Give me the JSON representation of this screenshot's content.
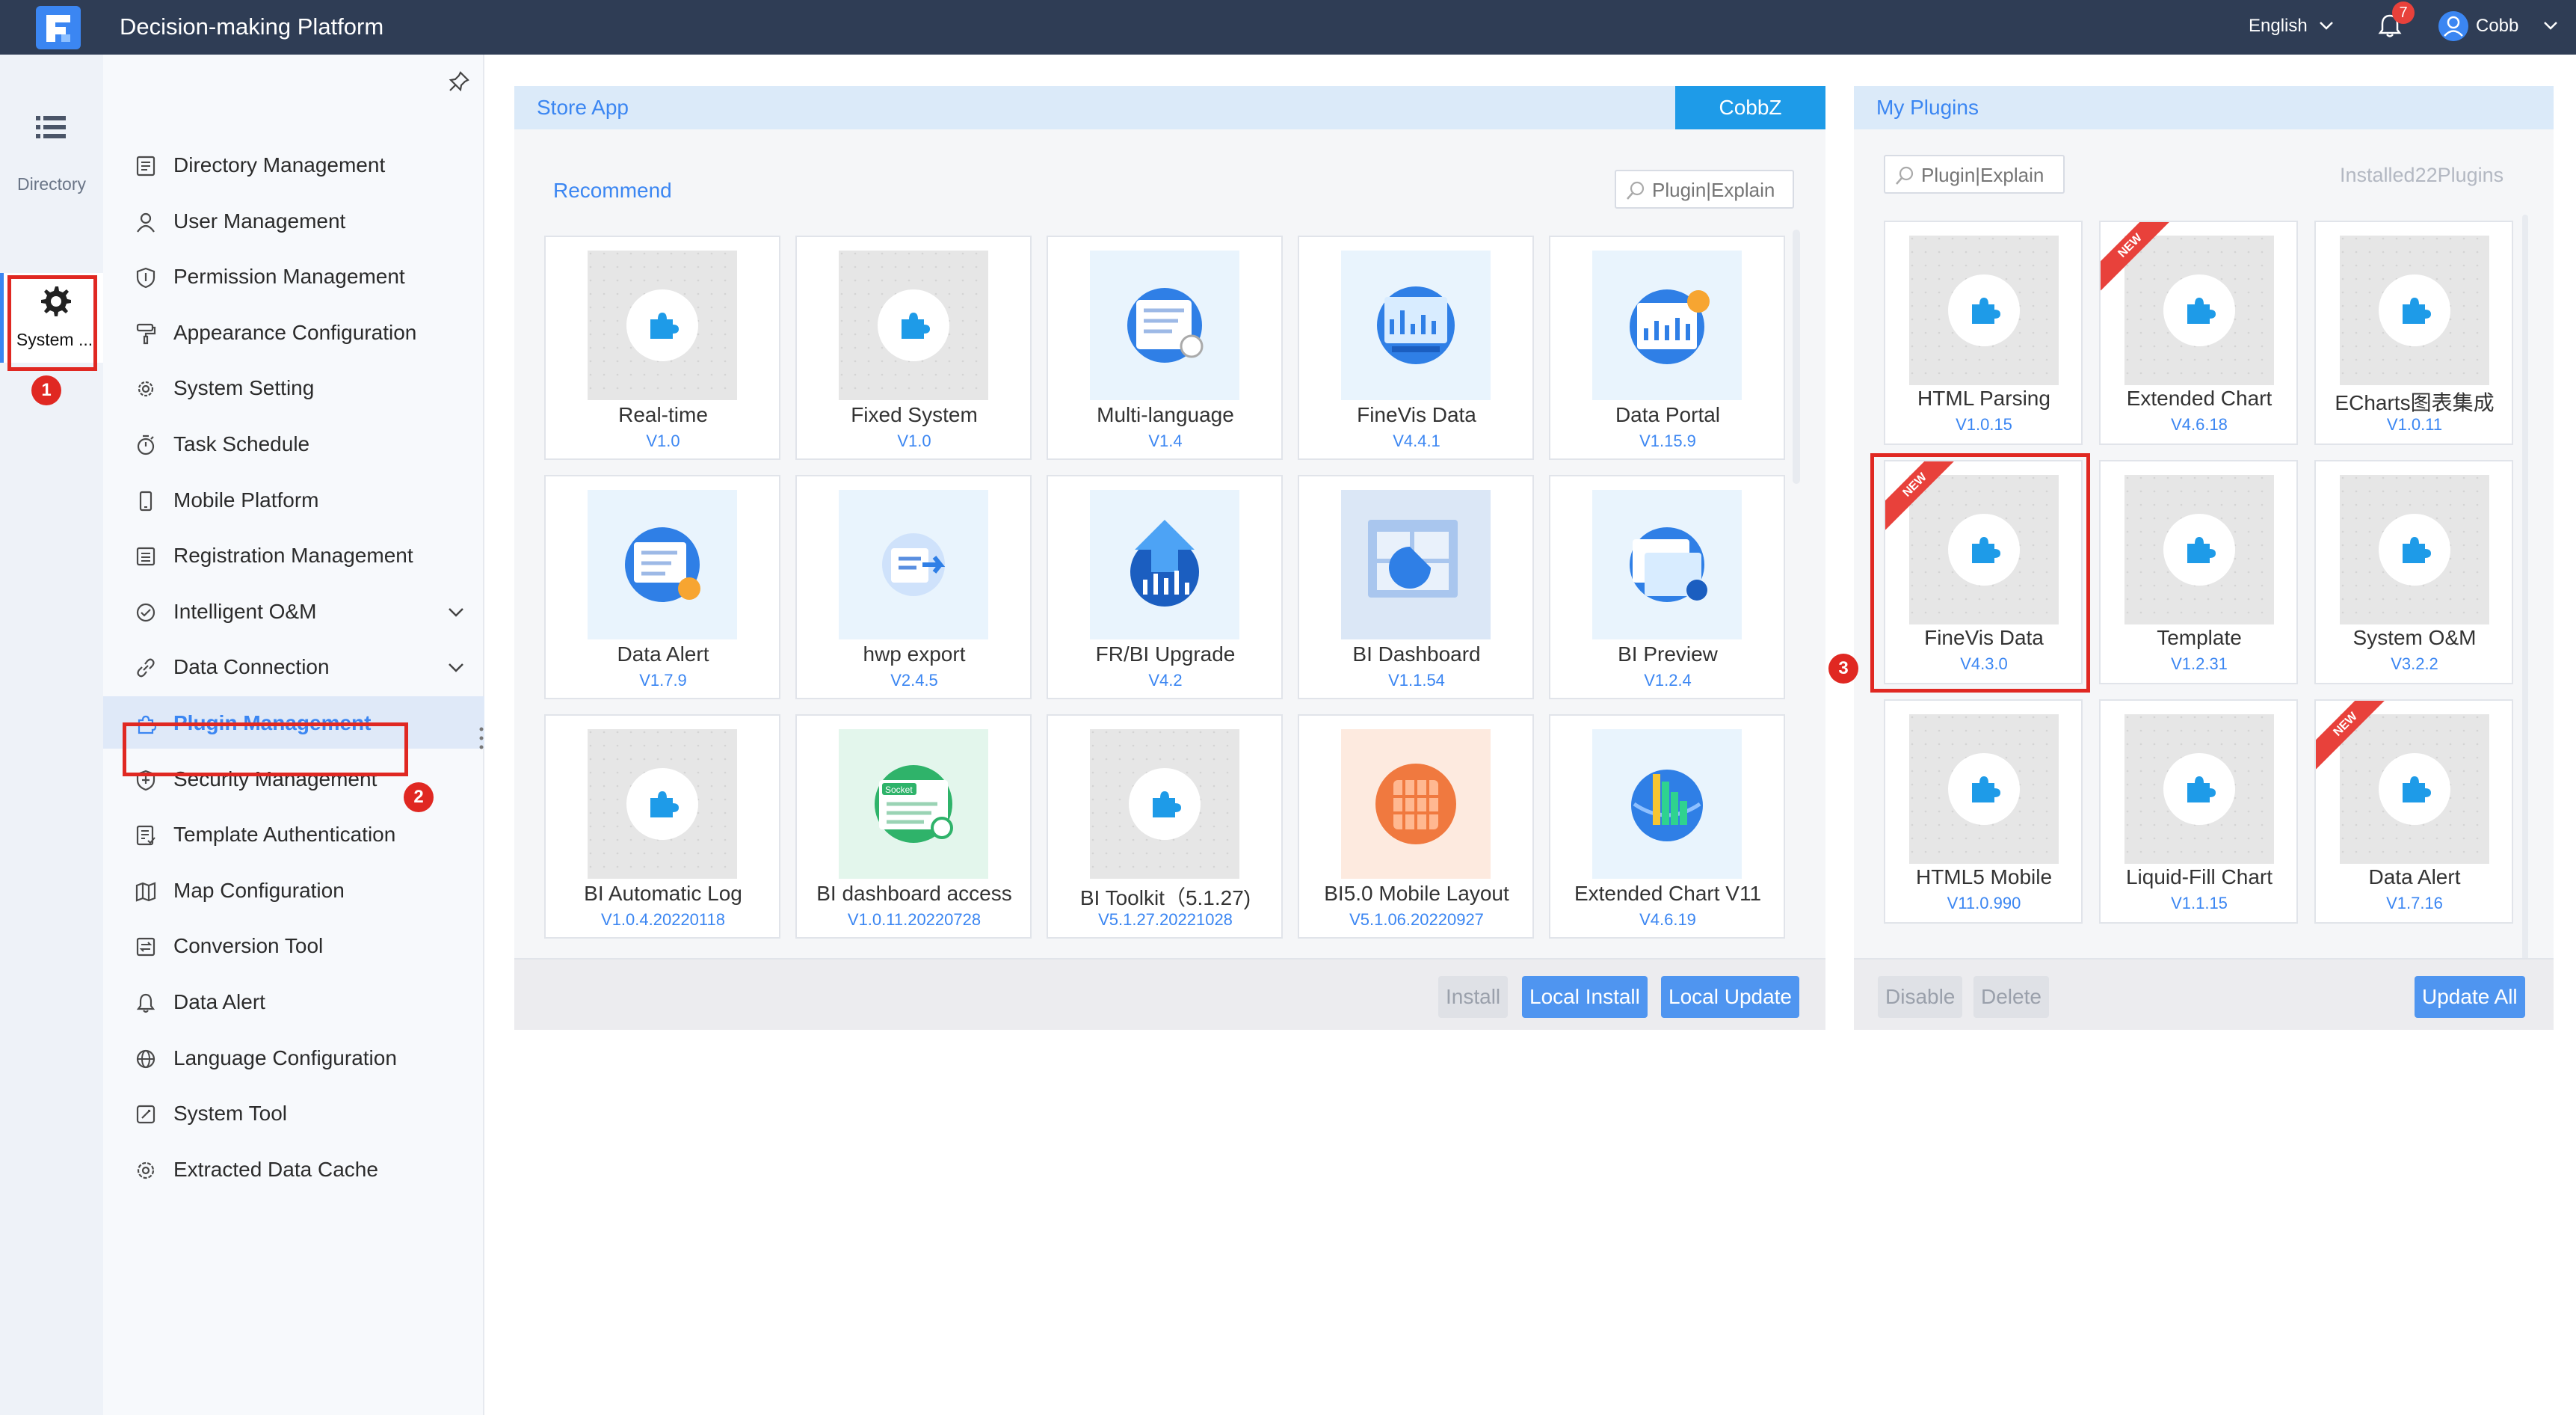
{
  "app": {
    "title": "Decision-making Platform"
  },
  "topbar": {
    "language": "English",
    "notification_count": "7",
    "user_name": "Cobb"
  },
  "rail": {
    "directory_label": "Directory",
    "system_label": "System ..."
  },
  "nav": {
    "items": [
      {
        "label": "Directory Management",
        "icon": "directory-icon"
      },
      {
        "label": "User Management",
        "icon": "user-icon"
      },
      {
        "label": "Permission Management",
        "icon": "shield-icon"
      },
      {
        "label": "Appearance Configuration",
        "icon": "paint-roller-icon"
      },
      {
        "label": "System Setting",
        "icon": "gear-icon"
      },
      {
        "label": "Task Schedule",
        "icon": "timer-icon"
      },
      {
        "label": "Mobile Platform",
        "icon": "mobile-icon"
      },
      {
        "label": "Registration Management",
        "icon": "registration-icon"
      },
      {
        "label": "Intelligent O&M",
        "icon": "om-icon",
        "expandable": true
      },
      {
        "label": "Data Connection",
        "icon": "link-icon",
        "expandable": true
      },
      {
        "label": "Plugin Management",
        "icon": "plugin-icon",
        "active": true
      },
      {
        "label": "Security Management",
        "icon": "security-icon"
      },
      {
        "label": "Template Authentication",
        "icon": "template-auth-icon"
      },
      {
        "label": "Map Configuration",
        "icon": "map-icon"
      },
      {
        "label": "Conversion Tool",
        "icon": "conversion-icon"
      },
      {
        "label": "Data Alert",
        "icon": "bell-icon"
      },
      {
        "label": "Language Configuration",
        "icon": "globe-icon"
      },
      {
        "label": "System Tool",
        "icon": "tool-icon"
      },
      {
        "label": "Extracted Data Cache",
        "icon": "cache-icon"
      }
    ]
  },
  "store": {
    "title": "Store App",
    "account_tab": "CobbZ",
    "section_label": "Recommend",
    "search_placeholder": "Plugin|Explain",
    "cards": [
      {
        "name": "Real-time",
        "version": "V1.0",
        "thumb": "generic"
      },
      {
        "name": "Fixed System",
        "version": "V1.0",
        "thumb": "generic"
      },
      {
        "name": "Multi-language",
        "version": "V1.4",
        "thumb": "language"
      },
      {
        "name": "FineVis Data",
        "version": "V4.4.1",
        "thumb": "monitor"
      },
      {
        "name": "Data Portal",
        "version": "V1.15.9",
        "thumb": "portal"
      },
      {
        "name": "Data Alert",
        "version": "V1.7.9",
        "thumb": "alert"
      },
      {
        "name": "hwp export",
        "version": "V2.4.5",
        "thumb": "export"
      },
      {
        "name": "FR/BI Upgrade",
        "version": "V4.2",
        "thumb": "upgrade"
      },
      {
        "name": "BI Dashboard",
        "version": "V1.1.54",
        "thumb": "dashboard"
      },
      {
        "name": "BI Preview",
        "version": "V1.2.4",
        "thumb": "preview"
      },
      {
        "name": "BI Automatic Log",
        "version": "V1.0.4.20220118",
        "thumb": "generic"
      },
      {
        "name": "BI dashboard access",
        "version": "V1.0.11.20220728",
        "thumb": "socket",
        "socket_label": "Socket"
      },
      {
        "name": "BI Toolkit（5.1.27)",
        "version": "V5.1.27.20221028",
        "thumb": "generic"
      },
      {
        "name": "BI5.0 Mobile Layout",
        "version": "V5.1.06.20220927",
        "thumb": "mobile"
      },
      {
        "name": "Extended Chart V11",
        "version": "V4.6.19",
        "thumb": "globe"
      }
    ],
    "buttons": {
      "install": "Install",
      "local_install": "Local Install",
      "local_update": "Local Update"
    }
  },
  "plugins": {
    "title": "My Plugins",
    "search_placeholder": "Plugin|Explain",
    "installed_count": "Installed22Plugins",
    "ribbon_label": "NEW",
    "cards": [
      {
        "name": "HTML Parsing",
        "version": "V1.0.15",
        "new": false
      },
      {
        "name": "Extended Chart",
        "version": "V4.6.18",
        "new": true
      },
      {
        "name": "ECharts图表集成",
        "version": "V1.0.11",
        "new": false
      },
      {
        "name": "FineVis Data",
        "version": "V4.3.0",
        "new": true
      },
      {
        "name": "Template",
        "version": "V1.2.31",
        "new": false
      },
      {
        "name": "System O&M",
        "version": "V3.2.2",
        "new": false
      },
      {
        "name": "HTML5 Mobile",
        "version": "V11.0.990",
        "new": false
      },
      {
        "name": "Liquid-Fill Chart",
        "version": "V1.1.15",
        "new": false
      },
      {
        "name": "Data Alert",
        "version": "V1.7.16",
        "new": true
      }
    ],
    "buttons": {
      "disable": "Disable",
      "delete": "Delete",
      "update_all": "Update All"
    }
  },
  "annotations": {
    "step1": "1",
    "step2": "2",
    "step3": "3"
  },
  "colors": {
    "topbar": "#2f3d55",
    "accent": "#3b86f2",
    "annotation": "#e02822",
    "tab_active": "#1e9be8"
  }
}
